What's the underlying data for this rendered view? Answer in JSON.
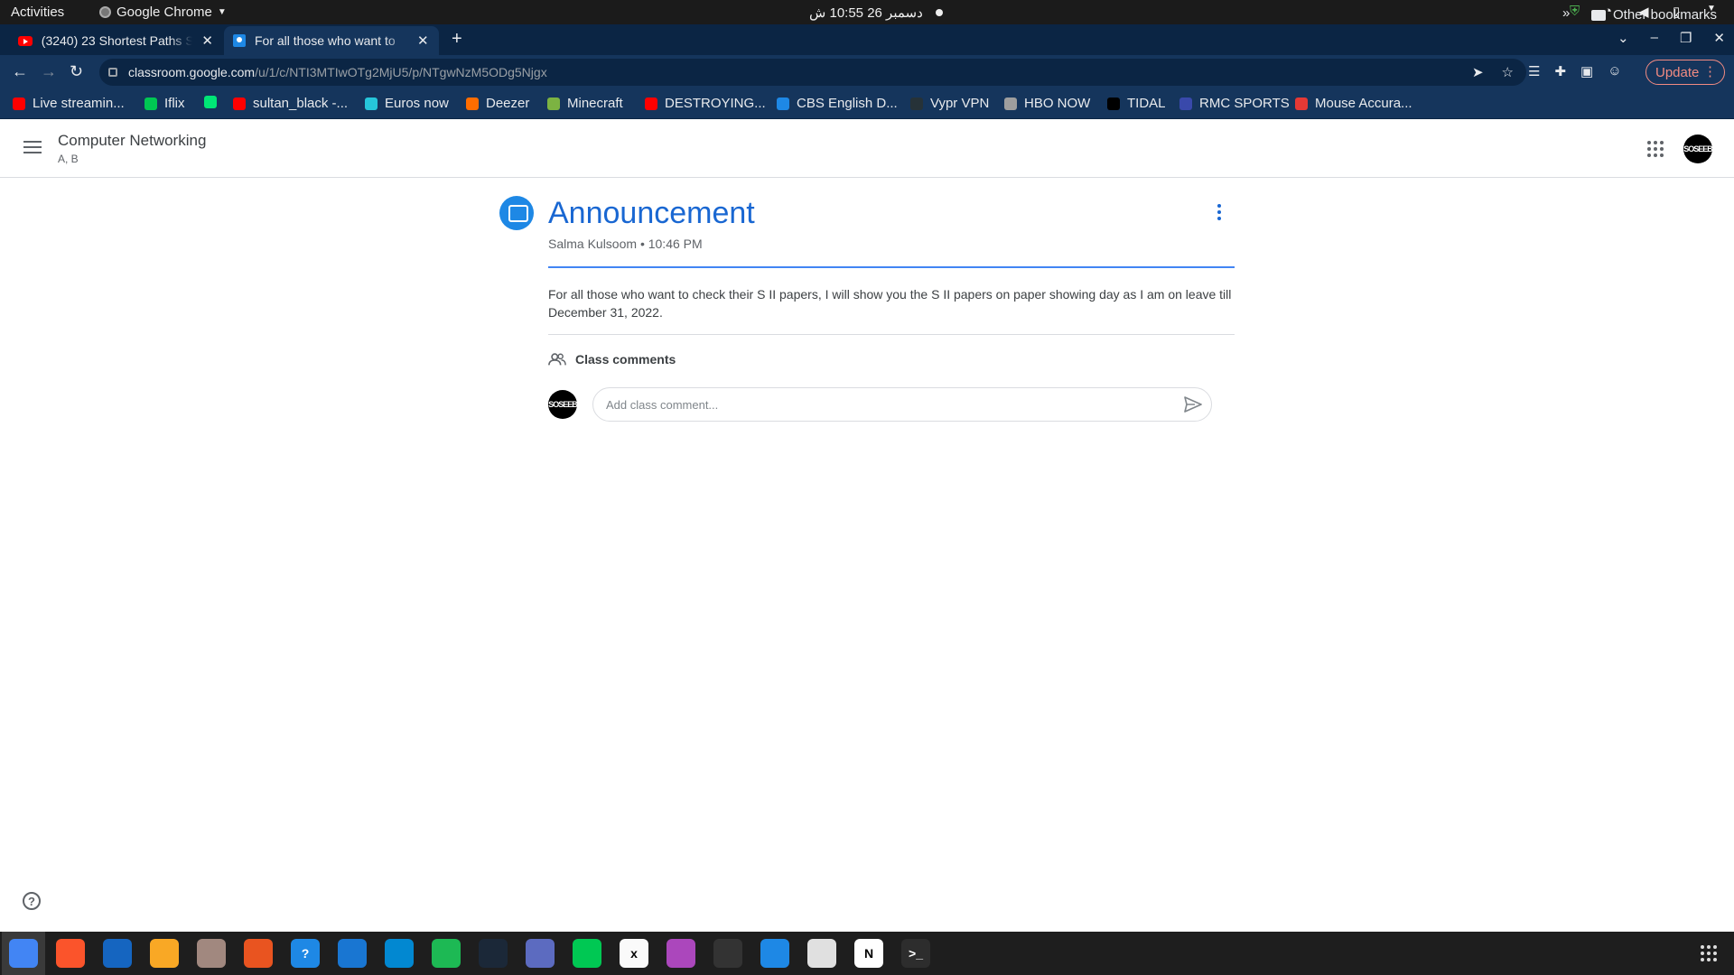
{
  "system": {
    "activities": "Activities",
    "app_name": "Google Chrome",
    "clock": "دسمبر 26  10:55 ش"
  },
  "browser": {
    "tabs": [
      {
        "label": "(3240) 23 Shortest Paths S"
      },
      {
        "label": "For all those who want to"
      }
    ],
    "url_host": "classroom.google.com",
    "url_path": "/u/1/c/NTI3MTIwOTg2MjU5/p/NTgwNzM5ODg5Njgx",
    "update_label": "Update",
    "bookmarks": [
      {
        "label": "Live streamin...",
        "color": "#ff0000"
      },
      {
        "label": "Iflix",
        "color": "#00c853"
      },
      {
        "label": "",
        "color": "#00e676"
      },
      {
        "label": "sultan_black -...",
        "color": "#ff0000"
      },
      {
        "label": "Euros now",
        "color": "#26c6da"
      },
      {
        "label": "Deezer",
        "color": "#ff6d00"
      },
      {
        "label": "Minecraft",
        "color": "#7cb342"
      },
      {
        "label": "DESTROYING...",
        "color": "#ff0000"
      },
      {
        "label": "CBS English D...",
        "color": "#1e88e5"
      },
      {
        "label": "Vypr VPN",
        "color": "#263238"
      },
      {
        "label": "HBO NOW",
        "color": "#9e9e9e"
      },
      {
        "label": "TIDAL",
        "color": "#000000"
      },
      {
        "label": "RMC SPORTS",
        "color": "#3949ab"
      },
      {
        "label": "Mouse Accura...",
        "color": "#e53935"
      }
    ],
    "other_bookmarks": "Other bookmarks"
  },
  "classroom": {
    "course_name": "Computer Networking",
    "course_section": "A, B",
    "avatar_text": "SOSEEB",
    "announcement": {
      "title": "Announcement",
      "author": "Salma Kulsoom",
      "time": "10:46 PM",
      "body": "For all those who want to check their S II papers, I will show you the S II papers on paper showing day as I am on leave till December 31, 2022."
    },
    "comments": {
      "heading": "Class comments",
      "placeholder": "Add class comment..."
    }
  },
  "dock": {
    "apps": [
      {
        "name": "chrome",
        "color": "#4285f4",
        "glyph": ""
      },
      {
        "name": "brave",
        "color": "#fb542b",
        "glyph": ""
      },
      {
        "name": "thunderbird",
        "color": "#1565c0",
        "glyph": ""
      },
      {
        "name": "rhythmbox",
        "color": "#f9a825",
        "glyph": ""
      },
      {
        "name": "files",
        "color": "#a1887f",
        "glyph": ""
      },
      {
        "name": "software",
        "color": "#e95420",
        "glyph": ""
      },
      {
        "name": "help",
        "color": "#1e88e5",
        "glyph": "?"
      },
      {
        "name": "writer",
        "color": "#1976d2",
        "glyph": ""
      },
      {
        "name": "vscode",
        "color": "#0288d1",
        "glyph": ""
      },
      {
        "name": "spotify",
        "color": "#1db954",
        "glyph": ""
      },
      {
        "name": "steam",
        "color": "#1b2838",
        "glyph": ""
      },
      {
        "name": "screenshot",
        "color": "#5c6bc0",
        "glyph": ""
      },
      {
        "name": "terminal-ide",
        "color": "#00c853",
        "glyph": ""
      },
      {
        "name": "xournal",
        "color": "#fafafa",
        "glyph": "x"
      },
      {
        "name": "video",
        "color": "#ab47bc",
        "glyph": ""
      },
      {
        "name": "obs",
        "color": "#333333",
        "glyph": ""
      },
      {
        "name": "editor",
        "color": "#1e88e5",
        "glyph": ""
      },
      {
        "name": "document-viewer",
        "color": "#e0e0e0",
        "glyph": ""
      },
      {
        "name": "notion",
        "color": "#ffffff",
        "glyph": "N"
      },
      {
        "name": "terminal",
        "color": "#2d2d2d",
        "glyph": ">_"
      }
    ]
  }
}
